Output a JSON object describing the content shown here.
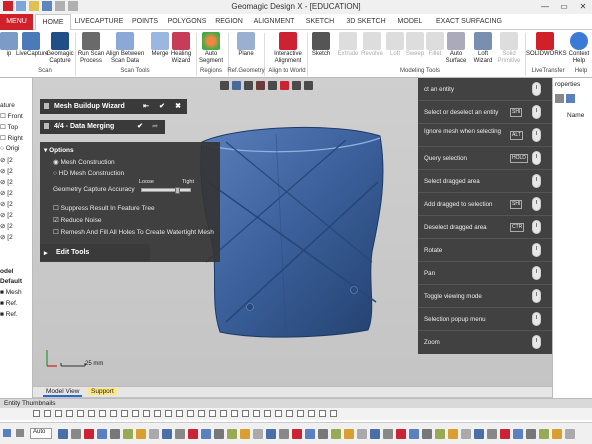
{
  "window": {
    "title": "Geomagic Design X - [EDUCATION]",
    "minimize": "—",
    "maximize": "▭",
    "close": "✕"
  },
  "ribbon": {
    "tabs": [
      "MENU",
      "HOME",
      "LIVECAPTURE",
      "POINTS",
      "POLYGONS",
      "REGION",
      "ALIGNMENT",
      "SKETCH",
      "3D SKETCH",
      "MODEL",
      "EXACT SURFACING"
    ],
    "active_tab": "HOME",
    "buttons": [
      {
        "label": "ip",
        "group": ""
      },
      {
        "label": "LiveCapture",
        "group": "Scan"
      },
      {
        "label": "Geomagic Capture",
        "group": "Scan"
      },
      {
        "label": "Run Scan Process",
        "group": "Scan Tools"
      },
      {
        "label": "Align Between Scan Data",
        "group": "Scan Tools"
      },
      {
        "label": "Merge",
        "group": "Scan Tools"
      },
      {
        "label": "Healing Wizard",
        "group": "Scan Tools"
      },
      {
        "label": "Auto Segment",
        "group": "Regions"
      },
      {
        "label": "Plane",
        "group": "Ref.Geometry"
      },
      {
        "label": "Interactive Alignment",
        "group": "Align to World"
      },
      {
        "label": "Sketch",
        "group": "Modeling Tools"
      },
      {
        "label": "Extrude",
        "group": "Modeling Tools"
      },
      {
        "label": "Revolve",
        "group": "Modeling Tools"
      },
      {
        "label": "Loft",
        "group": "Modeling Tools"
      },
      {
        "label": "Sweep",
        "group": "Modeling Tools"
      },
      {
        "label": "Fillet",
        "group": "Modeling Tools"
      },
      {
        "label": "Auto Surface",
        "group": "Modeling Tools"
      },
      {
        "label": "Loft Wizard",
        "group": "Modeling Tools"
      },
      {
        "label": "Solid Primitive",
        "group": "Modeling Tools"
      },
      {
        "label": "SOLIDWORKS",
        "group": "LiveTransfer"
      },
      {
        "label": "Context Help",
        "group": "Help"
      }
    ],
    "groups": [
      "Scan",
      "Scan Tools",
      "Regions",
      "Ref.Geometry",
      "Align to World",
      "Modeling Tools",
      "LiveTransfer",
      "Help"
    ]
  },
  "left_panel": {
    "tab_label": "ature",
    "tree": [
      "Front",
      "Top",
      "Right",
      "Origi",
      "[2",
      "[2",
      "[2",
      "[2",
      "[2",
      "[2",
      "[2",
      "[2"
    ],
    "model_label": "odel",
    "default_label": "Default",
    "model_items": [
      "Mesh",
      "Ref.",
      "Ref."
    ]
  },
  "right_panel": {
    "title": "roperties",
    "name_label": "Name"
  },
  "wizard": {
    "title": "Mesh Buildup Wizard",
    "step": "4/4 - Data Merging",
    "options_title": "Options",
    "radio_mesh": "Mesh Construction",
    "radio_hd": "HD Mesh Construction",
    "accuracy_label": "Geometry Capture Accuracy",
    "slider_loose": "Loose",
    "slider_tight": "Tight",
    "accuracy_level": 0.75,
    "chk_suppress": "Suppress Result In Feature Tree",
    "chk_noise": "Reduce Noise",
    "chk_remesh": "Remesh And Fill All Holes To Create Watertight Mesh",
    "edit_tools": "Edit Tools"
  },
  "mouse_help": [
    {
      "label": "ct an entity",
      "key": ""
    },
    {
      "label": "Select or deselect an entity",
      "key": "SHI"
    },
    {
      "label": "Ignore mesh when selecting",
      "key": "ALT"
    },
    {
      "label": "Query selection",
      "key": "HOLD"
    },
    {
      "label": "Select dragged area",
      "key": ""
    },
    {
      "label": "Add dragged to selection",
      "key": "SHI"
    },
    {
      "label": "Deselect dragged area",
      "key": "CTR"
    },
    {
      "label": "Rotate",
      "key": ""
    },
    {
      "label": "Pan",
      "key": ""
    },
    {
      "label": "Toggle viewing mode",
      "key": ""
    },
    {
      "label": "Selection popup menu",
      "key": ""
    },
    {
      "label": "Zoom",
      "key": ""
    }
  ],
  "viewport": {
    "scale": "25 mm",
    "tab_model_view": "Model View",
    "tab_support": "Support"
  },
  "bottom": {
    "thumbnails_label": "Entity Thumbnails",
    "status_auto": "Auto"
  },
  "colors": {
    "brand_red": "#d0202a",
    "mesh_blue": "#3a5f9a",
    "panel_dark": "#3a3a3a"
  }
}
